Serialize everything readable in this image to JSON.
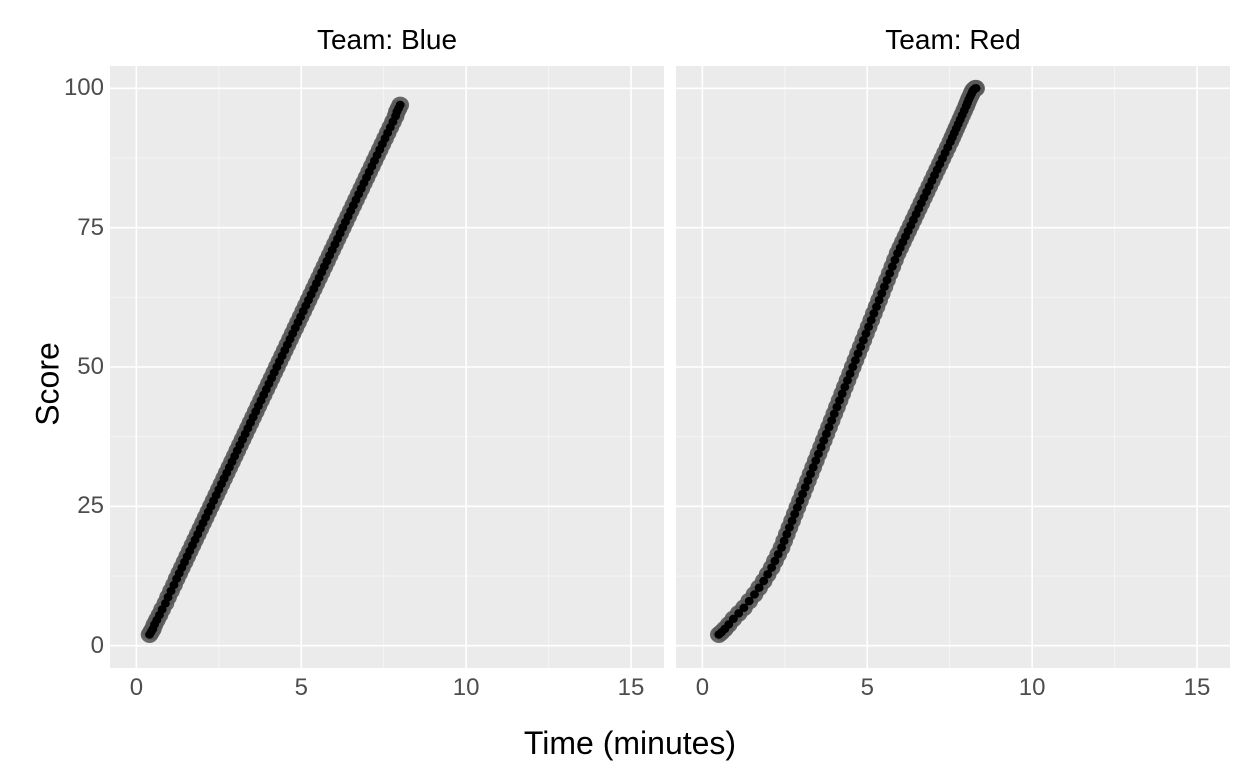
{
  "axis": {
    "xlabel": "Time (minutes)",
    "ylabel": "Score",
    "x_ticks": [
      0,
      5,
      10,
      15
    ],
    "y_ticks": [
      0,
      25,
      50,
      75,
      100
    ],
    "xlim": [
      -0.8,
      16
    ],
    "ylim": [
      -4,
      104
    ]
  },
  "facets": [
    {
      "title": "Team: Blue",
      "series_key": "blue"
    },
    {
      "title": "Team: Red",
      "series_key": "red"
    }
  ],
  "chart_data": [
    {
      "type": "scatter",
      "facet": "Team: Blue",
      "title": "Team: Blue",
      "xlabel": "Time (minutes)",
      "ylabel": "Score",
      "xlim": [
        0,
        15
      ],
      "ylim": [
        0,
        100
      ],
      "series": [
        {
          "name": "blue",
          "x": [
            0.4,
            0.45,
            0.5,
            0.55,
            0.62,
            0.7,
            0.78,
            0.88,
            0.96,
            1.05,
            1.14,
            1.22,
            1.3,
            1.38,
            1.46,
            1.54,
            1.62,
            1.7,
            1.78,
            1.86,
            1.94,
            2.02,
            2.1,
            2.18,
            2.26,
            2.34,
            2.42,
            2.5,
            2.58,
            2.66,
            2.74,
            2.82,
            2.9,
            2.98,
            3.06,
            3.14,
            3.22,
            3.3,
            3.38,
            3.46,
            3.54,
            3.62,
            3.7,
            3.78,
            3.86,
            3.94,
            4.02,
            4.1,
            4.18,
            4.26,
            4.34,
            4.42,
            4.5,
            4.58,
            4.66,
            4.74,
            4.82,
            4.9,
            4.98,
            5.06,
            5.14,
            5.22,
            5.3,
            5.38,
            5.46,
            5.54,
            5.62,
            5.7,
            5.78,
            5.86,
            5.94,
            6.02,
            6.1,
            6.18,
            6.26,
            6.34,
            6.42,
            6.5,
            6.58,
            6.66,
            6.74,
            6.82,
            6.9,
            6.98,
            7.06,
            7.14,
            7.22,
            7.3,
            7.38,
            7.46,
            7.54,
            7.62,
            7.7,
            7.78,
            7.86,
            7.9,
            7.95,
            8.0
          ],
          "y": [
            2.0,
            2.5,
            3.0,
            3.8,
            4.6,
            5.5,
            6.5,
            7.6,
            8.7,
            9.8,
            10.9,
            12.0,
            13.0,
            14.0,
            15.0,
            16.0,
            17.0,
            18.0,
            19.0,
            20.0,
            21.0,
            22.0,
            23.0,
            24.0,
            25.0,
            26.0,
            27.0,
            28.0,
            29.0,
            30.0,
            31.0,
            32.0,
            33.0,
            34.0,
            35.0,
            36.0,
            37.0,
            38.0,
            39.0,
            40.0,
            41.0,
            42.0,
            43.0,
            44.0,
            45.0,
            46.0,
            47.0,
            48.0,
            49.0,
            50.0,
            51.0,
            52.0,
            53.0,
            54.0,
            55.0,
            56.0,
            57.0,
            58.0,
            59.0,
            60.0,
            61.0,
            62.0,
            63.0,
            64.0,
            65.0,
            66.0,
            67.0,
            68.0,
            69.0,
            70.0,
            71.0,
            72.0,
            73.0,
            74.0,
            75.0,
            76.0,
            77.0,
            78.0,
            79.0,
            80.0,
            81.0,
            82.0,
            83.0,
            84.0,
            85.0,
            86.0,
            87.0,
            88.0,
            89.0,
            90.0,
            91.0,
            92.0,
            93.0,
            94.0,
            95.0,
            95.8,
            96.4,
            97.0
          ]
        }
      ]
    },
    {
      "type": "scatter",
      "facet": "Team: Red",
      "title": "Team: Red",
      "xlabel": "Time (minutes)",
      "ylabel": "Score",
      "xlim": [
        0,
        15
      ],
      "ylim": [
        0,
        100
      ],
      "series": [
        {
          "name": "red",
          "x": [
            0.5,
            0.58,
            0.68,
            0.8,
            0.94,
            1.1,
            1.26,
            1.42,
            1.58,
            1.72,
            1.86,
            1.98,
            2.1,
            2.2,
            2.3,
            2.4,
            2.48,
            2.56,
            2.64,
            2.72,
            2.8,
            2.88,
            2.96,
            3.04,
            3.12,
            3.2,
            3.28,
            3.36,
            3.44,
            3.52,
            3.6,
            3.68,
            3.76,
            3.84,
            3.92,
            4.0,
            4.08,
            4.16,
            4.24,
            4.32,
            4.4,
            4.48,
            4.56,
            4.64,
            4.72,
            4.8,
            4.88,
            4.96,
            5.04,
            5.12,
            5.2,
            5.28,
            5.36,
            5.44,
            5.52,
            5.6,
            5.68,
            5.76,
            5.84,
            5.92,
            6.0,
            6.08,
            6.16,
            6.24,
            6.32,
            6.4,
            6.48,
            6.56,
            6.64,
            6.72,
            6.8,
            6.88,
            6.96,
            7.04,
            7.12,
            7.2,
            7.28,
            7.36,
            7.44,
            7.52,
            7.58,
            7.64,
            7.7,
            7.76,
            7.82,
            7.88,
            7.94,
            8.0,
            8.04,
            8.08,
            8.12,
            8.16,
            8.18,
            8.2,
            8.22,
            8.24,
            8.26,
            8.28,
            8.3
          ],
          "y": [
            2.0,
            2.4,
            3.0,
            3.8,
            4.8,
            5.8,
            6.8,
            8.0,
            9.2,
            10.4,
            11.6,
            12.8,
            14.0,
            15.2,
            16.4,
            17.6,
            18.8,
            20.0,
            21.2,
            22.4,
            23.6,
            24.8,
            26.0,
            27.2,
            28.4,
            29.6,
            30.8,
            32.0,
            33.2,
            34.4,
            35.6,
            36.8,
            38.0,
            39.2,
            40.4,
            41.6,
            42.8,
            44.0,
            45.2,
            46.4,
            47.6,
            48.8,
            50.0,
            51.2,
            52.4,
            53.6,
            54.8,
            56.0,
            57.2,
            58.4,
            59.6,
            60.8,
            62.0,
            63.2,
            64.4,
            65.6,
            66.8,
            68.0,
            69.2,
            70.4,
            71.4,
            72.4,
            73.4,
            74.4,
            75.4,
            76.4,
            77.4,
            78.4,
            79.4,
            80.4,
            81.4,
            82.4,
            83.4,
            84.4,
            85.4,
            86.4,
            87.4,
            88.4,
            89.4,
            90.4,
            91.2,
            92.0,
            92.8,
            93.6,
            94.4,
            95.2,
            96.0,
            96.8,
            97.4,
            98.0,
            98.5,
            99.0,
            99.3,
            99.5,
            99.7,
            99.8,
            99.9,
            100.0,
            100.0
          ]
        }
      ]
    }
  ]
}
